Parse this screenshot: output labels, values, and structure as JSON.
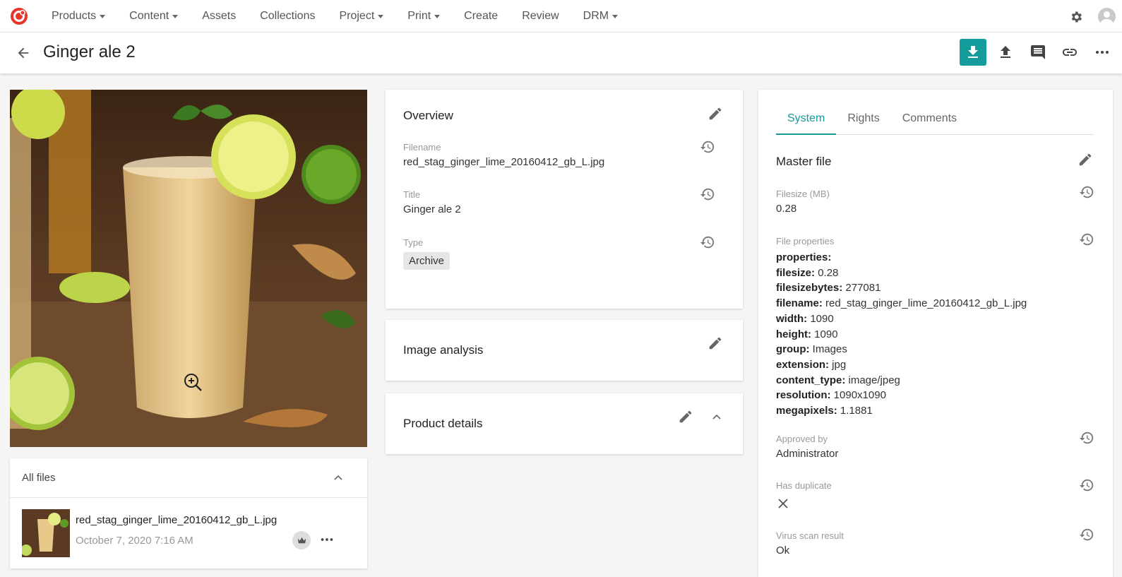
{
  "nav": {
    "items": [
      {
        "label": "Products",
        "dropdown": true
      },
      {
        "label": "Content",
        "dropdown": true
      },
      {
        "label": "Assets",
        "dropdown": false
      },
      {
        "label": "Collections",
        "dropdown": false
      },
      {
        "label": "Project",
        "dropdown": true
      },
      {
        "label": "Print",
        "dropdown": true
      },
      {
        "label": "Create",
        "dropdown": false
      },
      {
        "label": "Review",
        "dropdown": false
      },
      {
        "label": "DRM",
        "dropdown": true
      }
    ],
    "icons": [
      "logo-icon",
      "gear-icon",
      "user-avatar-icon"
    ]
  },
  "header": {
    "title": "Ginger ale 2",
    "actions": [
      "download-icon",
      "upload-icon",
      "comment-icon",
      "link-icon",
      "more-icon"
    ],
    "accent_color": "#149b9b"
  },
  "all_files": {
    "title": "All files",
    "file": {
      "name": "red_stag_ginger_lime_20160412_gb_L.jpg",
      "date": "October 7, 2020 7:16 AM"
    }
  },
  "overview": {
    "title": "Overview",
    "fields": {
      "filename_label": "Filename",
      "filename_value": "red_stag_ginger_lime_20160412_gb_L.jpg",
      "title_label": "Title",
      "title_value": "Ginger ale 2",
      "type_label": "Type",
      "type_value": "Archive"
    }
  },
  "image_analysis": {
    "title": "Image analysis"
  },
  "product_details": {
    "title": "Product details"
  },
  "right_panel": {
    "tabs": [
      "System",
      "Rights",
      "Comments"
    ],
    "active_tab": "System",
    "section_title": "Master file",
    "filesize_label": "Filesize (MB)",
    "filesize_value": "0.28",
    "file_properties_label": "File properties",
    "properties": [
      {
        "key": "properties:",
        "value": ""
      },
      {
        "key": "filesize:",
        "value": " 0.28"
      },
      {
        "key": "filesizebytes:",
        "value": " 277081"
      },
      {
        "key": "filename:",
        "value": " red_stag_ginger_lime_20160412_gb_L.jpg"
      },
      {
        "key": "width:",
        "value": " 1090"
      },
      {
        "key": "height:",
        "value": " 1090"
      },
      {
        "key": "group:",
        "value": " Images"
      },
      {
        "key": "extension:",
        "value": " jpg"
      },
      {
        "key": "content_type:",
        "value": " image/jpeg"
      },
      {
        "key": "resolution:",
        "value": " 1090x1090"
      },
      {
        "key": "megapixels:",
        "value": " 1.1881"
      }
    ],
    "approved_by_label": "Approved by",
    "approved_by_value": "Administrator",
    "has_duplicate_label": "Has duplicate",
    "virus_scan_label": "Virus scan result",
    "virus_scan_value": "Ok"
  }
}
